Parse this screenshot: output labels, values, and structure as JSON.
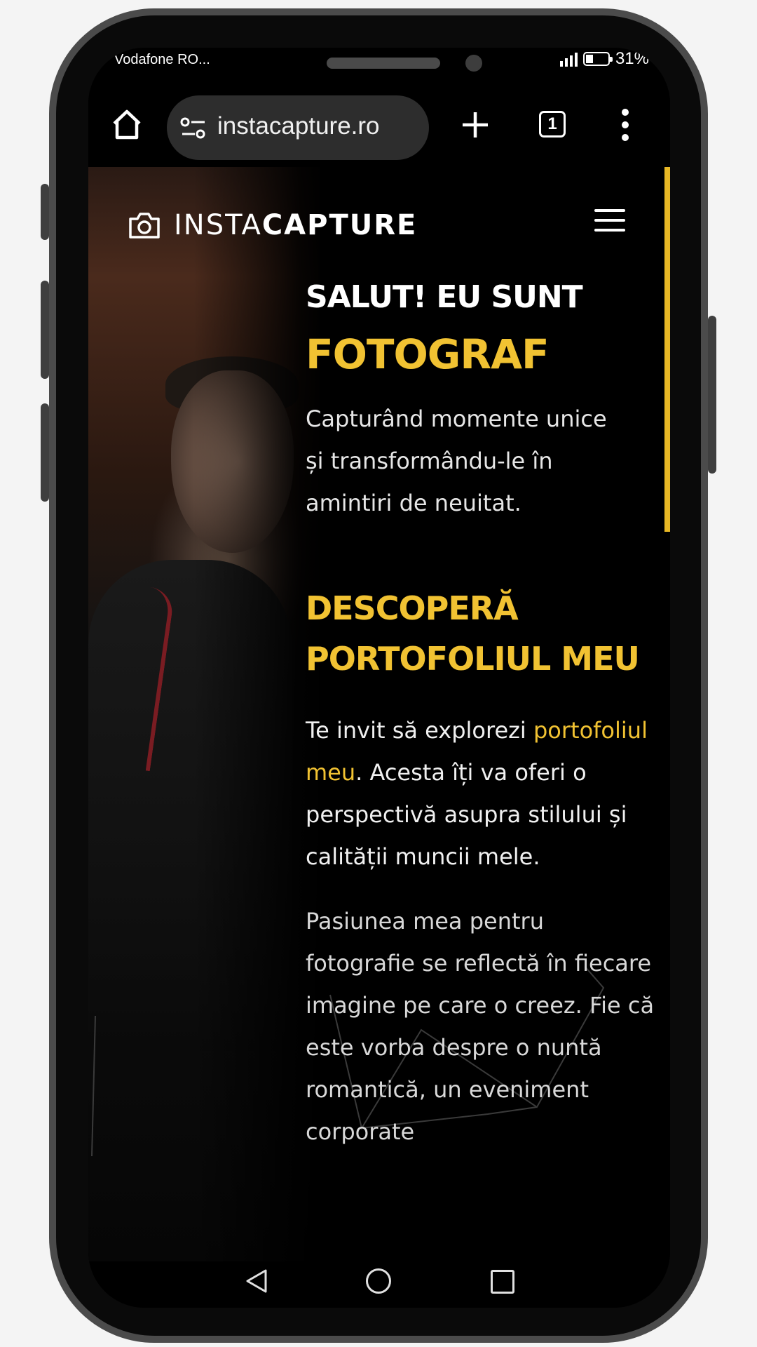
{
  "status_bar": {
    "carrier": "Vodafone RO...",
    "battery": "31%"
  },
  "browser": {
    "url": "instacapture.ro",
    "tab_count": "1"
  },
  "site": {
    "logo_light": "INSTA",
    "logo_bold": "CAPTURE",
    "accent_color": "#f1c232"
  },
  "hero": {
    "greeting": "SALUT! EU SUNT",
    "role": "FOTOGRAF",
    "tagline_lines": [
      "Capturând momente unice",
      "și transformându-le în",
      "amintiri de neuitat."
    ]
  },
  "portfolio": {
    "heading_lines": [
      "DESCOPERĂ",
      "PORTOFOLIUL MEU"
    ],
    "p1_before": "Te invit să explorezi",
    "p1_link": "portofoliul meu",
    "p1_after": ". Acesta îți va oferi o perspectivă asupra stilului și calității muncii mele.",
    "p2": "Pasiunea mea pentru fotografie se reflectă în fiecare imagine pe care o creez. Fie că este vorba despre o nuntă romantică, un eveniment corporate"
  }
}
